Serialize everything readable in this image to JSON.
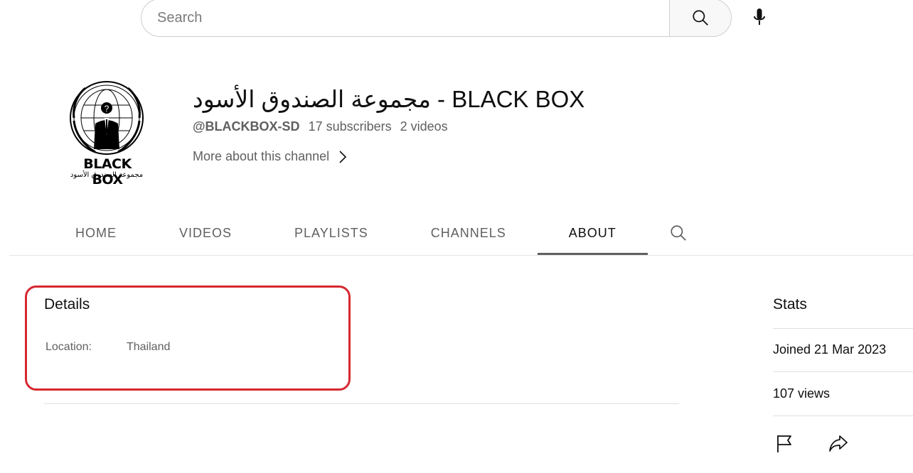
{
  "search": {
    "placeholder": "Search",
    "search_icon": "search-icon",
    "mic_icon": "microphone-icon"
  },
  "channel": {
    "avatar_text_main": "BLACK BOX",
    "avatar_text_sub": "مجموعة الصندوق الأسود",
    "title": "مجموعة الصندوق الأسود - BLACK BOX",
    "handle": "@BLACKBOX-SD",
    "subscribers": "17 subscribers",
    "videos": "2 videos",
    "more_about": "More about this channel"
  },
  "tabs": [
    {
      "label": "HOME"
    },
    {
      "label": "VIDEOS"
    },
    {
      "label": "PLAYLISTS"
    },
    {
      "label": "CHANNELS"
    },
    {
      "label": "ABOUT",
      "active": true
    }
  ],
  "details": {
    "title": "Details",
    "location_label": "Location:",
    "location_value": "Thailand",
    "highlight_color": "#d62830"
  },
  "stats": {
    "title": "Stats",
    "joined": "Joined 21 Mar 2023",
    "views": "107 views",
    "report_icon": "flag-icon",
    "share_icon": "share-icon"
  }
}
